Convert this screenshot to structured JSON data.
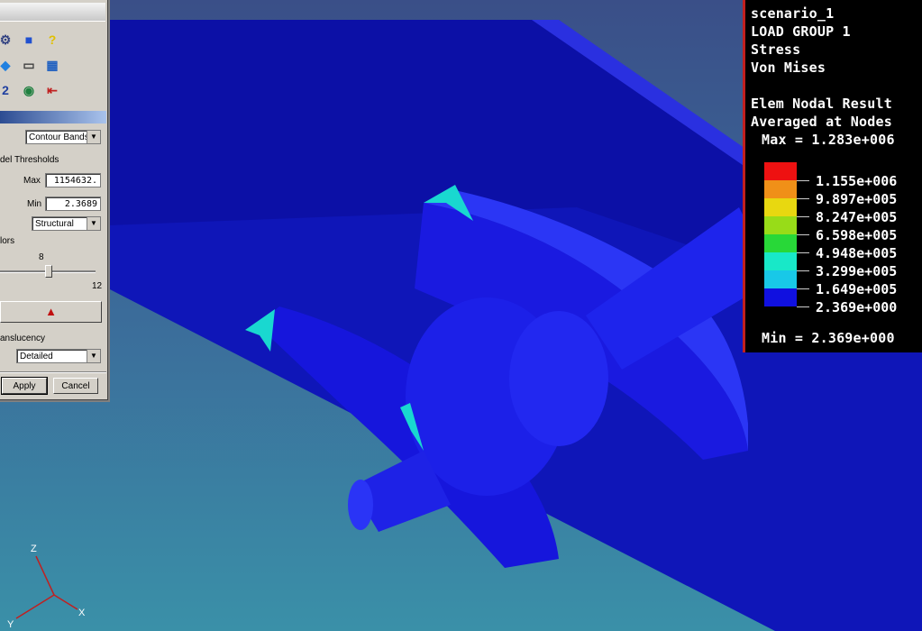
{
  "panel": {
    "display_mode": "Contour Bands",
    "thresholds_label": "del Thresholds",
    "max_label": "Max",
    "max_value": "1154632.",
    "min_label": "Min",
    "min_value": "2.3689",
    "spectrum": "Structural",
    "colors_label": "lors",
    "slider_value_label": "8",
    "slider_max_label": "12",
    "slider_fraction": 0.6,
    "translucency_label": "anslucency",
    "translucency": "Detailed",
    "apply_label": "Apply",
    "cancel_label": "Cancel",
    "toolbar_icons": [
      "node-icon",
      "cube-icon",
      "help-icon",
      "mesh-cube-icon",
      "window-icon",
      "grid-icon",
      "numeric-icon",
      "eye-icon",
      "door-exit-icon"
    ]
  },
  "legend": {
    "line1": "scenario_1",
    "line2": "LOAD GROUP 1",
    "line3": "Stress",
    "line4": "Von Mises",
    "line5": "Elem Nodal Result",
    "line6": "Averaged at Nodes",
    "max_text": "Max = 1.283e+006",
    "min_text": "Min = 2.369e+000",
    "levels": [
      "1.155e+006",
      "9.897e+005",
      "8.247e+005",
      "6.598e+005",
      "4.948e+005",
      "3.299e+005",
      "1.649e+005",
      "2.369e+000"
    ],
    "band_colors": [
      "#ee1111",
      "#f09018",
      "#e8d810",
      "#98dc18",
      "#28d838",
      "#18e8c8",
      "#18c8e8",
      "#1010e0"
    ]
  },
  "axes": {
    "z": "Z",
    "x": "X",
    "y": "Y"
  }
}
